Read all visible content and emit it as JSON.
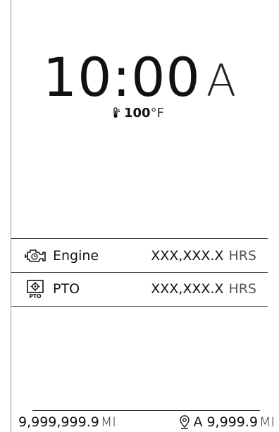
{
  "clock": {
    "time": "10:00",
    "period": "A"
  },
  "temperature": {
    "icon": "thermometer-icon",
    "value": "100",
    "unit": "°F"
  },
  "hours": [
    {
      "icon": "engine-icon",
      "label": "Engine",
      "value": "XXX,XXX.X",
      "unit": "HRS"
    },
    {
      "icon": "pto-icon",
      "label": "PTO",
      "value": "XXX,XXX.X",
      "unit": "HRS",
      "icon_text": "PTO"
    }
  ],
  "odometer": {
    "value": "9,999,999.9",
    "unit": "MI"
  },
  "trip": {
    "icon": "location-pin-icon",
    "label": "A",
    "value": "9,999.9",
    "unit": "MI"
  }
}
